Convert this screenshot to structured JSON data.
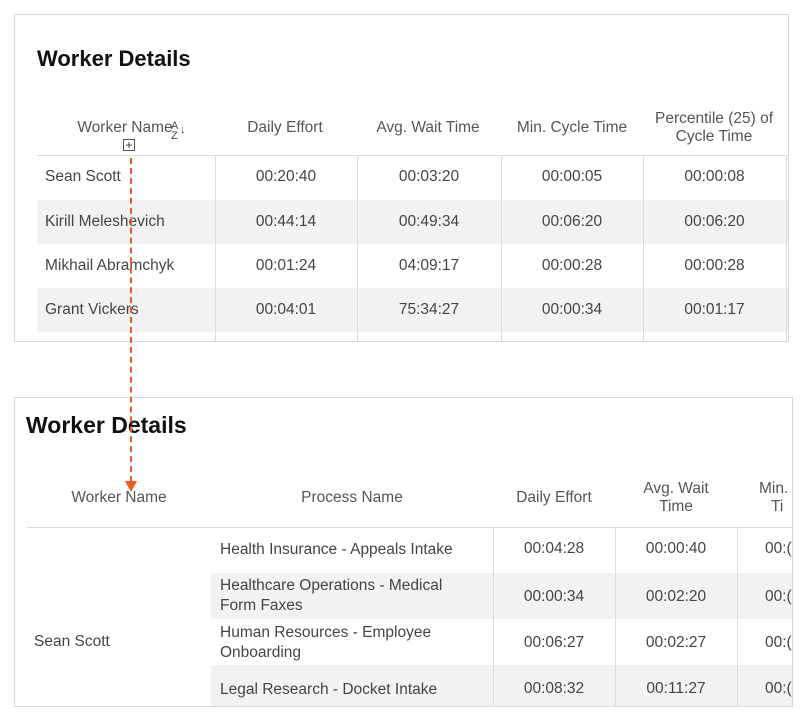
{
  "panel1": {
    "title": "Worker Details",
    "headers": [
      "Worker Name",
      "Daily Effort",
      "Avg. Wait Time",
      "Min. Cycle Time",
      "Percentile (25) of",
      "Cycle Time"
    ],
    "sort_icon": "sort-az-icon",
    "expand_icon": "plus-box-icon",
    "rows": [
      [
        "Sean Scott",
        "00:20:40",
        "00:03:20",
        "00:00:05",
        "00:00:08"
      ],
      [
        "Kirill Meleshevich",
        "00:44:14",
        "00:49:34",
        "00:06:20",
        "00:06:20"
      ],
      [
        "Mikhail Abramchyk",
        "00:01:24",
        "04:09:17",
        "00:00:28",
        "00:00:28"
      ],
      [
        "Grant Vickers",
        "00:04:01",
        "75:34:27",
        "00:00:34",
        "00:01:17"
      ]
    ]
  },
  "panel2": {
    "title": "Worker Details",
    "headers": [
      "Worker Name",
      "Process Name",
      "Daily Effort",
      "Avg. Wait",
      "Time",
      "Min.",
      "Ti"
    ],
    "worker": "Sean Scott",
    "rows": [
      {
        "process": [
          "Health Insurance - Appeals Intake",
          ""
        ],
        "effort": "00:04:28",
        "wait": "00:00:40",
        "min": "00:("
      },
      {
        "process": [
          "Healthcare Operations - Medical",
          "Form Faxes"
        ],
        "effort": "00:00:34",
        "wait": "00:02:20",
        "min": "00:("
      },
      {
        "process": [
          "Human Resources - Employee",
          "Onboarding"
        ],
        "effort": "00:06:27",
        "wait": "00:02:27",
        "min": "00:("
      },
      {
        "process": [
          "Legal Research - Docket Intake",
          ""
        ],
        "effort": "00:08:32",
        "wait": "00:11:27",
        "min": "00:("
      }
    ]
  },
  "annotation": {
    "arrow_color": "#f05a22"
  }
}
